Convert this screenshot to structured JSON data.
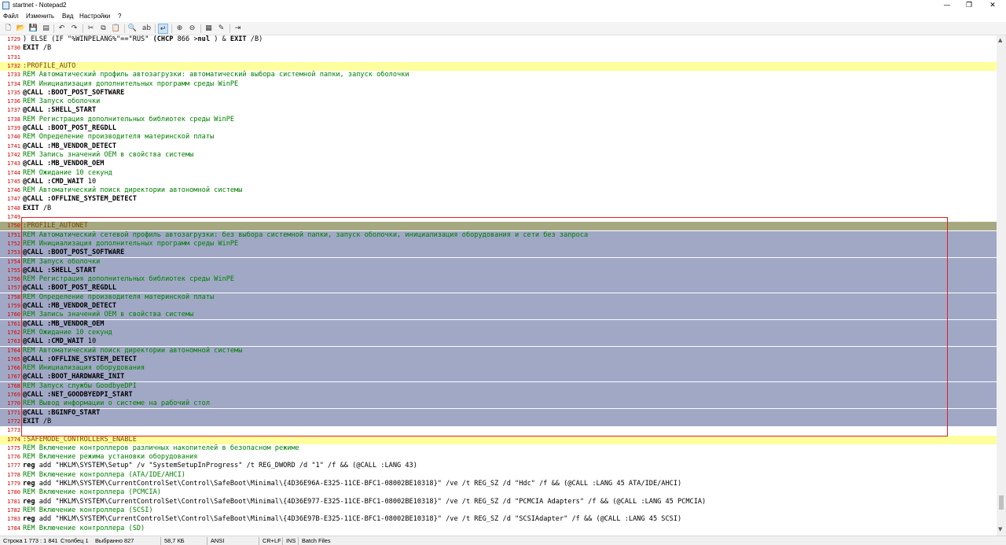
{
  "window": {
    "title": "startnet - Notepad2",
    "minimize": "—",
    "maximize": "❐",
    "close": "✕"
  },
  "menu": [
    "Файл",
    "Изменить",
    "Вид",
    "Настройки",
    "?"
  ],
  "toolbar": [
    "new-icon",
    "open-icon",
    "save-icon",
    "browse-icon",
    "undo-icon",
    "redo-icon",
    "cut-icon",
    "copy-icon",
    "paste-icon",
    "find-icon",
    "replace-icon",
    "wordwrap-icon",
    "zoom-in-icon",
    "zoom-out-icon",
    "scheme-icon",
    "customize-icon",
    "exit-icon"
  ],
  "editor": {
    "lines": [
      {
        "n": "1729",
        "hl": "",
        "s": [
          [
            "",
            ") ELSE (IF \"%WINPELANG%\"==\"RUS\" "
          ],
          [
            "kw",
            "(CHCP"
          ],
          [
            "",
            " 866 >"
          ],
          [
            "kw",
            "nul"
          ],
          [
            "",
            " ) & "
          ],
          [
            "kw",
            "EXIT"
          ],
          [
            "",
            " /B)"
          ]
        ]
      },
      {
        "n": "1730",
        "hl": "",
        "s": [
          [
            "kw",
            "EXIT"
          ],
          [
            "",
            " /B"
          ]
        ]
      },
      {
        "n": "1731",
        "hl": "",
        "s": []
      },
      {
        "n": "1732",
        "hl": "yellow",
        "s": [
          [
            "label",
            ":PROFILE_AUTO"
          ]
        ]
      },
      {
        "n": "1733",
        "hl": "",
        "s": [
          [
            "rem",
            "REM Автоматический профиль автозагрузки: автоматический выбора системной папки, запуск оболочки"
          ]
        ]
      },
      {
        "n": "1734",
        "hl": "",
        "s": [
          [
            "rem",
            "REM Инициализация дополнительных программ среды WinPE"
          ]
        ]
      },
      {
        "n": "1735",
        "hl": "",
        "s": [
          [
            "kw",
            "@CALL :BOOT_POST_SOFTWARE"
          ]
        ]
      },
      {
        "n": "1736",
        "hl": "",
        "s": [
          [
            "rem",
            "REM Запуск оболочки"
          ]
        ]
      },
      {
        "n": "1737",
        "hl": "",
        "s": [
          [
            "kw",
            "@CALL :SHELL_START"
          ]
        ]
      },
      {
        "n": "1738",
        "hl": "",
        "s": [
          [
            "rem",
            "REM Регистрация дополнительных библиотек среды WinPE"
          ]
        ]
      },
      {
        "n": "1739",
        "hl": "",
        "s": [
          [
            "kw",
            "@CALL :BOOT_POST_REGDLL"
          ]
        ]
      },
      {
        "n": "1740",
        "hl": "",
        "s": [
          [
            "rem",
            "REM Определение производителя материнской платы"
          ]
        ]
      },
      {
        "n": "1741",
        "hl": "",
        "s": [
          [
            "kw",
            "@CALL :MB_VENDOR_DETECT"
          ]
        ]
      },
      {
        "n": "1742",
        "hl": "",
        "s": [
          [
            "rem",
            "REM Запись значений OEM в свойства системы"
          ]
        ]
      },
      {
        "n": "1743",
        "hl": "",
        "s": [
          [
            "kw",
            "@CALL :MB_VENDOR_OEM"
          ]
        ]
      },
      {
        "n": "1744",
        "hl": "",
        "s": [
          [
            "rem",
            "REM Ожидание 10 секунд"
          ]
        ]
      },
      {
        "n": "1745",
        "hl": "",
        "s": [
          [
            "kw",
            "@CALL :CMD_WAIT"
          ],
          [
            "",
            " 10"
          ]
        ]
      },
      {
        "n": "1746",
        "hl": "",
        "s": [
          [
            "rem",
            "REM Автоматический поиск директории автономной системы"
          ]
        ]
      },
      {
        "n": "1747",
        "hl": "",
        "s": [
          [
            "kw",
            "@CALL :OFFLINE_SYSTEM_DETECT"
          ]
        ]
      },
      {
        "n": "1748",
        "hl": "",
        "s": [
          [
            "kw",
            "EXIT"
          ],
          [
            "",
            " /B"
          ]
        ]
      },
      {
        "n": "1749",
        "hl": "",
        "s": []
      },
      {
        "n": "1750",
        "hl": "olive",
        "s": [
          [
            "label",
            ":PROFILE_AUTONET"
          ]
        ]
      },
      {
        "n": "1751",
        "hl": "sel",
        "s": [
          [
            "rem",
            "REM Автоматический сетевой профиль автозагрузки: без выбора системной папки, запуск оболочки, инициализация оборудования и сети без запроса"
          ]
        ]
      },
      {
        "n": "1752",
        "hl": "sel",
        "s": [
          [
            "rem",
            "REM Инициализация дополнительных программ среды WinPE"
          ]
        ]
      },
      {
        "n": "1753",
        "hl": "sel",
        "s": [
          [
            "kw",
            "@CALL :BOOT_POST_SOFTWARE"
          ]
        ]
      },
      {
        "n": "1754",
        "hl": "sel",
        "s": [
          [
            "rem",
            "REM Запуск оболочки"
          ]
        ]
      },
      {
        "n": "1755",
        "hl": "sel",
        "s": [
          [
            "kw",
            "@CALL :SHELL_START"
          ]
        ]
      },
      {
        "n": "1756",
        "hl": "sel",
        "s": [
          [
            "rem",
            "REM Регистрация дополнительных библиотек среды WinPE"
          ]
        ]
      },
      {
        "n": "1757",
        "hl": "sel",
        "s": [
          [
            "kw",
            "@CALL :BOOT_POST_REGDLL"
          ]
        ]
      },
      {
        "n": "1758",
        "hl": "sel",
        "s": [
          [
            "rem",
            "REM Определение производителя материнской платы"
          ]
        ]
      },
      {
        "n": "1759",
        "hl": "sel",
        "s": [
          [
            "kw",
            "@CALL :MB_VENDOR_DETECT"
          ]
        ]
      },
      {
        "n": "1760",
        "hl": "sel",
        "s": [
          [
            "rem",
            "REM Запись значений OEM в свойства системы"
          ]
        ]
      },
      {
        "n": "1761",
        "hl": "sel",
        "s": [
          [
            "kw",
            "@CALL :MB_VENDOR_OEM"
          ]
        ]
      },
      {
        "n": "1762",
        "hl": "sel",
        "s": [
          [
            "rem",
            "REM Ожидание 10 секунд"
          ]
        ]
      },
      {
        "n": "1763",
        "hl": "sel",
        "s": [
          [
            "kw",
            "@CALL :CMD_WAIT"
          ],
          [
            "",
            " 10"
          ]
        ]
      },
      {
        "n": "1764",
        "hl": "sel",
        "s": [
          [
            "rem",
            "REM Автоматический поиск директории автономной системы"
          ]
        ]
      },
      {
        "n": "1765",
        "hl": "sel",
        "s": [
          [
            "kw",
            "@CALL :OFFLINE_SYSTEM_DETECT"
          ]
        ]
      },
      {
        "n": "1766",
        "hl": "sel",
        "s": [
          [
            "rem",
            "REM Инициализация оборудования"
          ]
        ]
      },
      {
        "n": "1767",
        "hl": "sel",
        "s": [
          [
            "kw",
            "@CALL :BOOT_HARDWARE_INIT"
          ]
        ]
      },
      {
        "n": "1768",
        "hl": "sel",
        "s": [
          [
            "rem",
            "REM Запуск службы GoodbyeDPI"
          ]
        ]
      },
      {
        "n": "1769",
        "hl": "sel",
        "s": [
          [
            "kw",
            "@CALL :NET_GOODBYEDPI_START"
          ]
        ]
      },
      {
        "n": "1770",
        "hl": "sel",
        "s": [
          [
            "rem",
            "REM Вывод информации о системе на рабочий стол"
          ]
        ]
      },
      {
        "n": "1771",
        "hl": "sel",
        "s": [
          [
            "kw",
            "@CALL :BGINFO_START"
          ]
        ]
      },
      {
        "n": "1772",
        "hl": "sel",
        "s": [
          [
            "kw",
            "EXIT"
          ],
          [
            "",
            " /B"
          ]
        ]
      },
      {
        "n": "1773",
        "hl": "",
        "s": []
      },
      {
        "n": "1774",
        "hl": "yellow",
        "s": [
          [
            "label",
            ":SAFEMODE_CONTROLLERS_ENABLE"
          ]
        ]
      },
      {
        "n": "1775",
        "hl": "",
        "s": [
          [
            "rem",
            "REM Включение контроллеров различных накопителей в безопасном режиме"
          ]
        ]
      },
      {
        "n": "1776",
        "hl": "",
        "s": [
          [
            "rem",
            "REM Включение режима установки оборудования"
          ]
        ]
      },
      {
        "n": "1777",
        "hl": "",
        "s": [
          [
            "kw",
            "reg"
          ],
          [
            "",
            " add \"HKLM\\SYSTEM\\Setup\" /v \"SystemSetupInProgress\" /t REG_DWORD /d \"1\" /f && (@CALL :LANG 43)"
          ]
        ]
      },
      {
        "n": "1778",
        "hl": "",
        "s": [
          [
            "rem",
            "REM Включение контроллера (ATA/IDE/AHCI)"
          ]
        ]
      },
      {
        "n": "1779",
        "hl": "",
        "s": [
          [
            "kw",
            "reg"
          ],
          [
            "",
            " add \"HKLM\\SYSTEM\\CurrentControlSet\\Control\\SafeBoot\\Minimal\\{4D36E96A-E325-11CE-BFC1-08002BE10318}\" /ve /t REG_SZ /d \"Hdc\" /f && (@CALL :LANG 45 ATA/IDE/AHCI)"
          ]
        ]
      },
      {
        "n": "1780",
        "hl": "",
        "s": [
          [
            "rem",
            "REM Включение контроллера (PCMCIA)"
          ]
        ]
      },
      {
        "n": "1781",
        "hl": "",
        "s": [
          [
            "kw",
            "reg"
          ],
          [
            "",
            " add \"HKLM\\SYSTEM\\CurrentControlSet\\Control\\SafeBoot\\Minimal\\{4D36E977-E325-11CE-BFC1-08002BE10318}\" /ve /t REG_SZ /d \"PCMCIA Adapters\" /f && (@CALL :LANG 45 PCMCIA)"
          ]
        ]
      },
      {
        "n": "1782",
        "hl": "",
        "s": [
          [
            "rem",
            "REM Включение контроллера (SCSI)"
          ]
        ]
      },
      {
        "n": "1783",
        "hl": "",
        "s": [
          [
            "kw",
            "reg"
          ],
          [
            "",
            " add \"HKLM\\SYSTEM\\CurrentControlSet\\Control\\SafeBoot\\Minimal\\{4D36E97B-E325-11CE-BFC1-08002BE10318}\" /ve /t REG_SZ /d \"SCSIAdapter\" /f && (@CALL :LANG 45 SCSI)"
          ]
        ]
      },
      {
        "n": "1784",
        "hl": "",
        "s": [
          [
            "rem",
            "REM Включение контроллера (SD)"
          ]
        ]
      }
    ]
  },
  "status": {
    "position": "Строка 1 773 : 1 841",
    "column": "Столбец 1",
    "selected": "Выбранно 827",
    "size": "58,7 КБ",
    "encoding": "ANSI",
    "eol": "CR+LF",
    "ins": "INS",
    "scheme": "Batch Files"
  }
}
